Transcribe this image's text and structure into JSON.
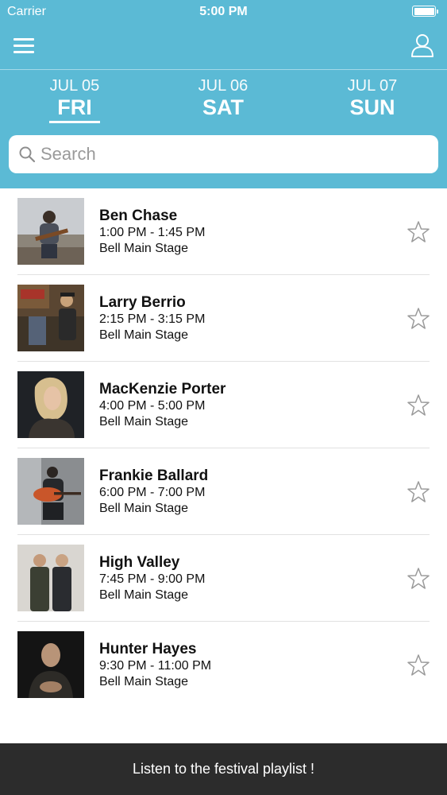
{
  "status": {
    "carrier": "Carrier",
    "time": "5:00 PM"
  },
  "nav": {
    "menu_icon": "menu-icon",
    "profile_icon": "user-icon"
  },
  "days": [
    {
      "date": "JUL 05",
      "weekday": "FRI",
      "selected": true
    },
    {
      "date": "JUL 06",
      "weekday": "SAT",
      "selected": false
    },
    {
      "date": "JUL 07",
      "weekday": "SUN",
      "selected": false
    }
  ],
  "search": {
    "placeholder": "Search",
    "icon": "search-icon"
  },
  "performances": [
    {
      "artist": "Ben Chase",
      "time": "1:00 PM - 1:45 PM",
      "stage": "Bell Main Stage",
      "favorite": false
    },
    {
      "artist": "Larry Berrio",
      "time": "2:15 PM - 3:15 PM",
      "stage": "Bell Main Stage",
      "favorite": false
    },
    {
      "artist": "MacKenzie Porter",
      "time": "4:00 PM - 5:00 PM",
      "stage": "Bell Main Stage",
      "favorite": false
    },
    {
      "artist": "Frankie Ballard",
      "time": "6:00 PM - 7:00 PM",
      "stage": "Bell Main Stage",
      "favorite": false
    },
    {
      "artist": "High Valley",
      "time": "7:45 PM - 9:00 PM",
      "stage": "Bell Main Stage",
      "favorite": false
    },
    {
      "artist": "Hunter Hayes",
      "time": "9:30 PM - 11:00 PM",
      "stage": "Bell Main Stage",
      "favorite": false
    }
  ],
  "footer": {
    "label": "Listen to the festival playlist !"
  },
  "colors": {
    "header": "#5bbad5",
    "footer": "#2c2c2c",
    "star": "#9a9a9a"
  }
}
